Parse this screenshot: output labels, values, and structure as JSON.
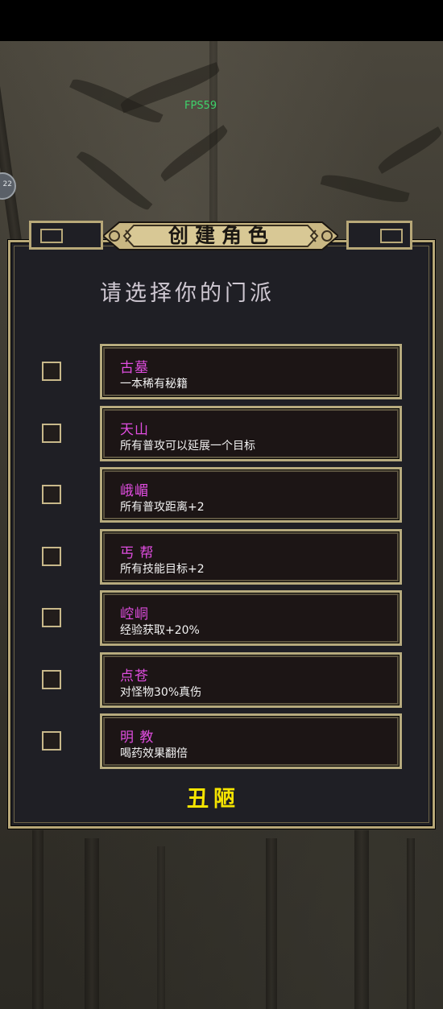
{
  "hud": {
    "fps": "FPS59",
    "avatar_level": "22"
  },
  "dialog": {
    "title": "创建角色",
    "subtitle": "请选择你的门派",
    "confirm_label": "丑陋"
  },
  "sects": [
    {
      "name": "古墓",
      "desc": "一本稀有秘籍",
      "checked": false
    },
    {
      "name": "天山",
      "desc": "所有普攻可以延展一个目标",
      "checked": false
    },
    {
      "name": "峨嵋",
      "desc": "所有普攻距离+2",
      "checked": false
    },
    {
      "name": "丐 帮",
      "desc": "所有技能目标+2",
      "checked": false
    },
    {
      "name": "崆峒",
      "desc": "经验获取+20%",
      "checked": false
    },
    {
      "name": "点苍",
      "desc": "对怪物30%真伤",
      "checked": false
    },
    {
      "name": "明 教",
      "desc": "喝药效果翻倍",
      "checked": false
    }
  ],
  "colors": {
    "sect_name": "#e04de0",
    "confirm": "#f5e400",
    "frame_gold": "#b8a878",
    "fps": "#3ed26a"
  }
}
